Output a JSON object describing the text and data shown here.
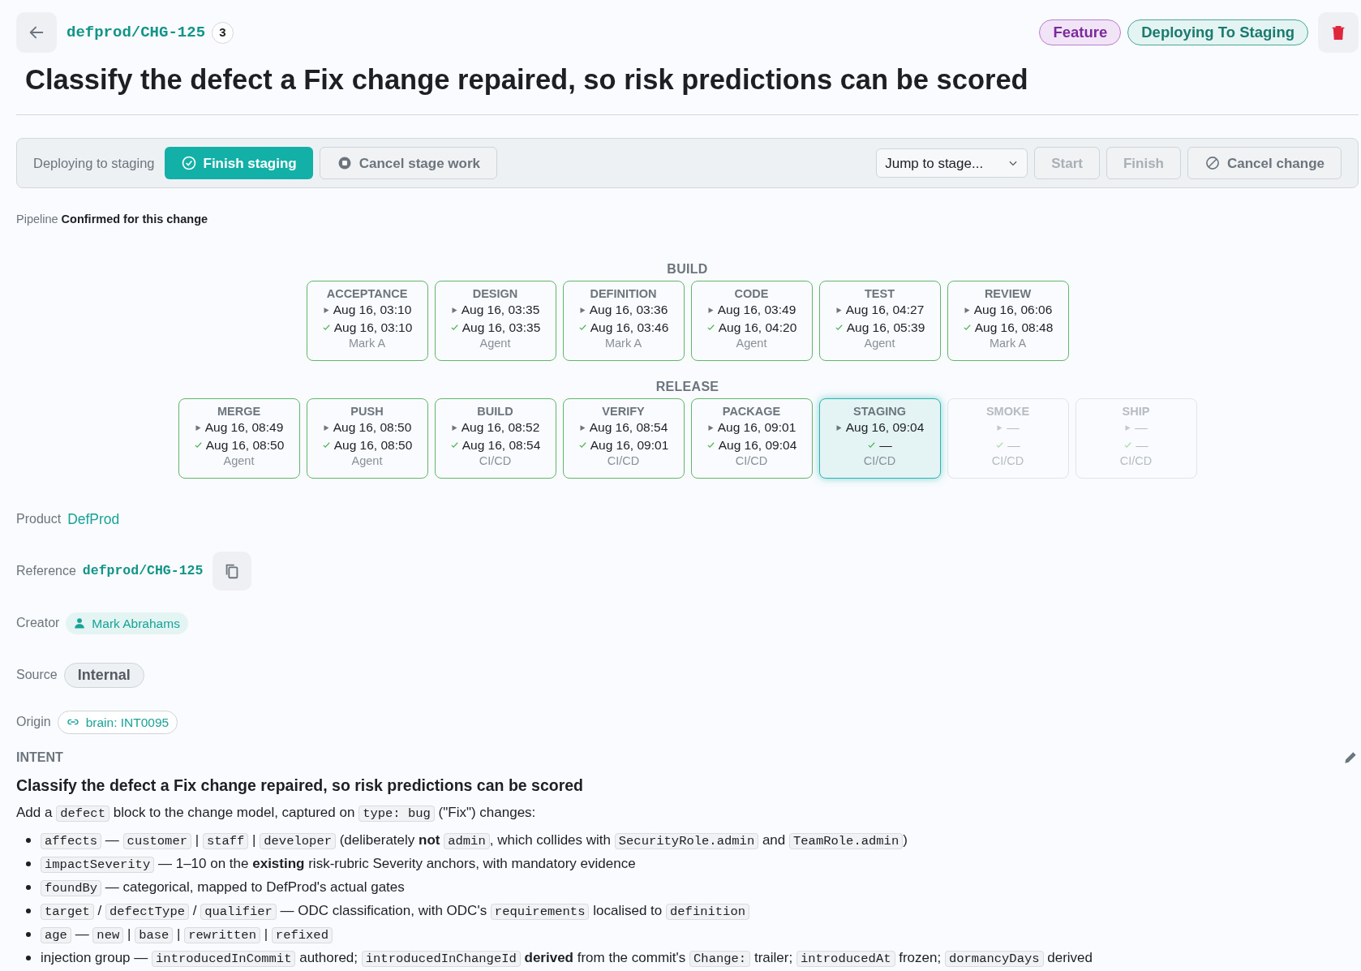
{
  "header": {
    "reference": "defprod/CHG-125",
    "count": "3",
    "tags": [
      {
        "label": "Feature",
        "kind": "type"
      },
      {
        "label": "Deploying To Staging",
        "kind": "status"
      }
    ]
  },
  "title": "Classify the defect a Fix change repaired, so risk predictions can be scored",
  "action_bar": {
    "stage_label": "Deploying to staging",
    "primary": "Finish staging",
    "secondary": "Cancel stage work",
    "jump": {
      "value": "Jump to stage..."
    },
    "buttons": [
      {
        "label": "Start",
        "kind": "plain",
        "disabled": true
      },
      {
        "label": "Finish",
        "kind": "plain",
        "disabled": true
      },
      {
        "label": "Cancel change",
        "kind": "cancel",
        "disabled": false
      }
    ]
  },
  "pipeline": {
    "label": "Pipeline",
    "value": "Confirmed for this change"
  },
  "groups": [
    {
      "name": "BUILD",
      "stages": [
        {
          "name": "ACCEPTANCE",
          "started": "Aug 16, 03:10",
          "finished": "Aug 16, 03:10",
          "actor": "Mark A",
          "selected": false,
          "disabled": false
        },
        {
          "name": "DESIGN",
          "started": "Aug 16, 03:35",
          "finished": "Aug 16, 03:35",
          "actor": "Agent",
          "selected": false,
          "disabled": false
        },
        {
          "name": "DEFINITION",
          "started": "Aug 16, 03:36",
          "finished": "Aug 16, 03:46",
          "actor": "Mark A",
          "selected": false,
          "disabled": false
        },
        {
          "name": "CODE",
          "started": "Aug 16, 03:49",
          "finished": "Aug 16, 04:20",
          "actor": "Agent",
          "selected": false,
          "disabled": false
        },
        {
          "name": "TEST",
          "started": "Aug 16, 04:27",
          "finished": "Aug 16, 05:39",
          "actor": "Agent",
          "selected": false,
          "disabled": false
        },
        {
          "name": "REVIEW",
          "started": "Aug 16, 06:06",
          "finished": "Aug 16, 08:48",
          "actor": "Mark A",
          "selected": false,
          "disabled": false
        }
      ]
    },
    {
      "name": "RELEASE",
      "stages": [
        {
          "name": "MERGE",
          "started": "Aug 16, 08:49",
          "finished": "Aug 16, 08:50",
          "actor": "Agent",
          "selected": false,
          "disabled": false
        },
        {
          "name": "PUSH",
          "started": "Aug 16, 08:50",
          "finished": "Aug 16, 08:50",
          "actor": "Agent",
          "selected": false,
          "disabled": false
        },
        {
          "name": "BUILD",
          "started": "Aug 16, 08:52",
          "finished": "Aug 16, 08:54",
          "actor": "CI/CD",
          "selected": false,
          "disabled": false
        },
        {
          "name": "VERIFY",
          "started": "Aug 16, 08:54",
          "finished": "Aug 16, 09:01",
          "actor": "CI/CD",
          "selected": false,
          "disabled": false
        },
        {
          "name": "PACKAGE",
          "started": "Aug 16, 09:01",
          "finished": "Aug 16, 09:04",
          "actor": "CI/CD",
          "selected": false,
          "disabled": false
        },
        {
          "name": "STAGING",
          "started": "Aug 16, 09:04",
          "finished": "—",
          "actor": "CI/CD",
          "selected": true,
          "disabled": false
        },
        {
          "name": "SMOKE",
          "started": "—",
          "finished": "—",
          "actor": "CI/CD",
          "selected": false,
          "disabled": true
        },
        {
          "name": "SHIP",
          "started": "—",
          "finished": "—",
          "actor": "CI/CD",
          "selected": false,
          "disabled": true
        }
      ]
    }
  ],
  "fields": [
    {
      "label": "Product",
      "kind": "link",
      "value": "DefProd"
    },
    {
      "label": "Reference",
      "kind": "code",
      "value": "defprod/CHG-125"
    },
    {
      "label": "Creator",
      "kind": "person",
      "value": "Mark Abrahams"
    },
    {
      "label": "Source",
      "kind": "pill",
      "value": "Internal"
    },
    {
      "label": "Origin",
      "kind": "origin",
      "value": "brain: INT0095"
    }
  ],
  "intent": {
    "label": "INTENT",
    "heading": "Classify the defect a Fix change repaired, so risk predictions can be scored",
    "paragraph": [
      {
        "kind": "text",
        "text": "Add a "
      },
      {
        "kind": "code",
        "text": "defect"
      },
      {
        "kind": "text",
        "text": " block to the change model, captured on "
      },
      {
        "kind": "code",
        "text": "type: bug"
      },
      {
        "kind": "text",
        "text": " (\"Fix\") changes:"
      }
    ],
    "bullets": [
      [
        {
          "kind": "code",
          "text": "affects"
        },
        {
          "kind": "text",
          "text": " — "
        },
        {
          "kind": "code",
          "text": "customer"
        },
        {
          "kind": "text",
          "text": " | "
        },
        {
          "kind": "code",
          "text": "staff"
        },
        {
          "kind": "text",
          "text": " | "
        },
        {
          "kind": "code",
          "text": "developer"
        },
        {
          "kind": "text",
          "text": " (deliberately **not** "
        },
        {
          "kind": "code",
          "text": "admin"
        },
        {
          "kind": "text",
          "text": ", which collides with "
        },
        {
          "kind": "code",
          "text": "SecurityRole.admin"
        },
        {
          "kind": "text",
          "text": " and "
        },
        {
          "kind": "code",
          "text": "TeamRole.admin"
        },
        {
          "kind": "text",
          "text": ")"
        }
      ],
      [
        {
          "kind": "code",
          "text": "impactSeverity"
        },
        {
          "kind": "text",
          "text": " — 1–10 on the **existing** risk-rubric Severity anchors, with mandatory evidence"
        }
      ],
      [
        {
          "kind": "code",
          "text": "foundBy"
        },
        {
          "kind": "text",
          "text": " — categorical, mapped to DefProd's actual gates"
        }
      ],
      [
        {
          "kind": "code",
          "text": "target"
        },
        {
          "kind": "text",
          "text": " / "
        },
        {
          "kind": "code",
          "text": "defectType"
        },
        {
          "kind": "text",
          "text": " / "
        },
        {
          "kind": "code",
          "text": "qualifier"
        },
        {
          "kind": "text",
          "text": " — ODC classification, with ODC's "
        },
        {
          "kind": "code",
          "text": "requirements"
        },
        {
          "kind": "text",
          "text": " localised to "
        },
        {
          "kind": "code",
          "text": "definition"
        }
      ],
      [
        {
          "kind": "code",
          "text": "age"
        },
        {
          "kind": "text",
          "text": " — "
        },
        {
          "kind": "code",
          "text": "new"
        },
        {
          "kind": "text",
          "text": " | "
        },
        {
          "kind": "code",
          "text": "base"
        },
        {
          "kind": "text",
          "text": " | "
        },
        {
          "kind": "code",
          "text": "rewritten"
        },
        {
          "kind": "text",
          "text": " | "
        },
        {
          "kind": "code",
          "text": "refixed"
        }
      ],
      [
        {
          "kind": "text",
          "text": "injection group — "
        },
        {
          "kind": "code",
          "text": "introducedInCommit"
        },
        {
          "kind": "text",
          "text": " authored; "
        },
        {
          "kind": "code",
          "text": "introducedInChangeId"
        },
        {
          "kind": "text",
          "text": " **derived** from the commit's "
        },
        {
          "kind": "code",
          "text": "Change:"
        },
        {
          "kind": "text",
          "text": " trailer; "
        },
        {
          "kind": "code",
          "text": "introducedAt"
        },
        {
          "kind": "text",
          "text": " frozen; "
        },
        {
          "kind": "code",
          "text": "dormancyDays"
        },
        {
          "kind": "text",
          "text": " derived"
        }
      ]
    ]
  }
}
